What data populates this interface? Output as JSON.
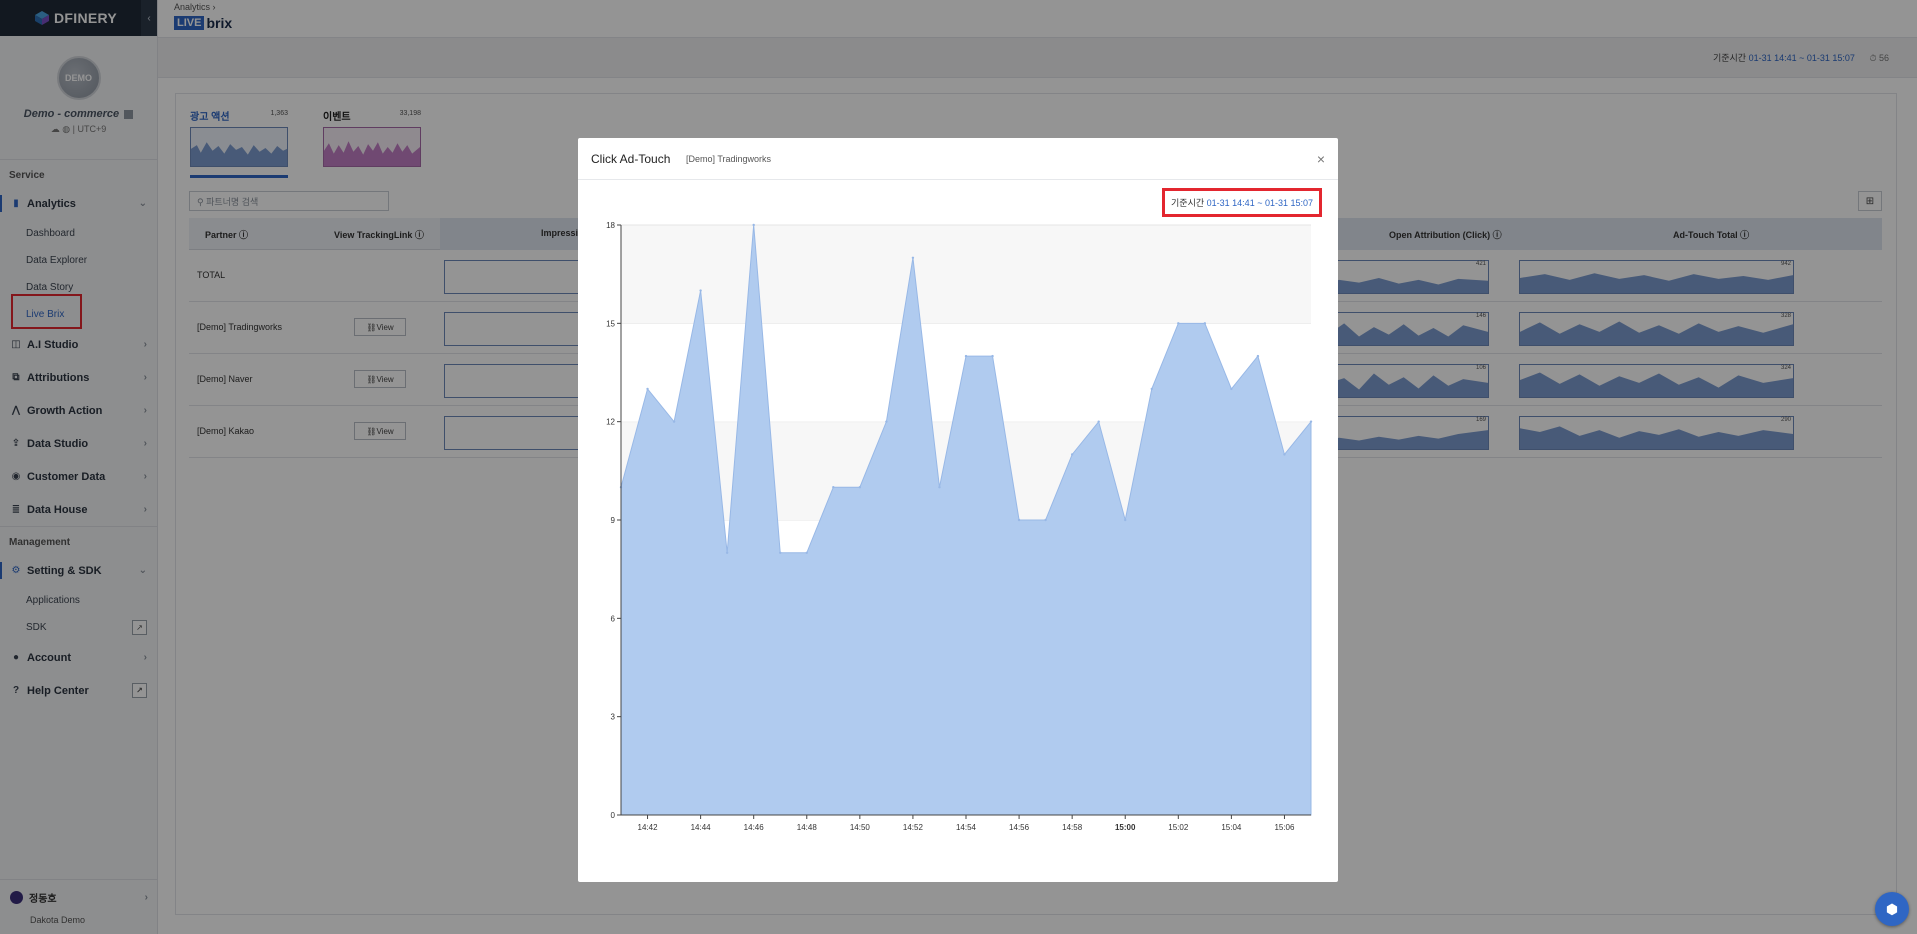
{
  "sidebar": {
    "logo": "DFINERY",
    "profile": {
      "avatar_text": "DEMO",
      "app_name": "Demo - commerce",
      "timezone": "UTC+9"
    },
    "section_service": "Service",
    "section_management": "Management",
    "analytics": {
      "label": "Analytics",
      "children": [
        "Dashboard",
        "Data Explorer",
        "Data Story",
        "Live Brix"
      ]
    },
    "items": [
      "A.I Studio",
      "Attributions",
      "Growth Action",
      "Data Studio",
      "Customer Data",
      "Data House"
    ],
    "setting": {
      "label": "Setting & SDK",
      "children": [
        "Applications",
        "SDK"
      ]
    },
    "account": "Account",
    "help_center": "Help Center",
    "user": {
      "name": "정동호",
      "org": "Dakota Demo"
    }
  },
  "header": {
    "breadcrumb": "Analytics",
    "breadcrumb_sep": "›",
    "product_live": "LIVE",
    "product_brix": "brix",
    "base_label": "기준시간",
    "base_range": "01-31 14:41 ~ 01-31 15:07",
    "counter": "⏱ 56"
  },
  "main": {
    "tabs": [
      {
        "label": "광고 액션",
        "count": "1,363"
      },
      {
        "label": "이벤트",
        "count": "33,198"
      }
    ],
    "search_placeholder": "파트너명 검색",
    "columns": [
      "Partner",
      "View TrackingLink",
      "Impression",
      "Open Attribution (Click)",
      "Ad-Touch Total"
    ],
    "rows": [
      {
        "partner": "TOTAL",
        "view": "",
        "open_attr_total": "421",
        "adtouch_total": "942"
      },
      {
        "partner": "[Demo] Tradingworks",
        "view": "View",
        "open_attr_total": "146",
        "adtouch_total": "328"
      },
      {
        "partner": "[Demo] Naver",
        "view": "View",
        "open_attr_total": "106",
        "adtouch_total": "324"
      },
      {
        "partner": "[Demo] Kakao",
        "view": "View",
        "open_attr_total": "169",
        "adtouch_total": "290"
      }
    ]
  },
  "modal": {
    "title": "Click Ad-Touch",
    "subtitle": "[Demo] Tradingworks",
    "close": "×",
    "base_label": "기준시간",
    "base_range": "01-31 14:41 ~ 01-31 15:07"
  },
  "colors": {
    "accent": "#2f66c4",
    "area_fill": "#b0cbef",
    "area_stroke": "#98b8e6",
    "highlight": "#e3262f"
  },
  "chart_data": {
    "type": "area",
    "title": "",
    "xlabel": "",
    "ylabel": "",
    "x": [
      "14:41",
      "14:42",
      "14:43",
      "14:44",
      "14:45",
      "14:46",
      "14:47",
      "14:48",
      "14:49",
      "14:50",
      "14:51",
      "14:52",
      "14:53",
      "14:54",
      "14:55",
      "14:56",
      "14:57",
      "14:58",
      "14:59",
      "15:00",
      "15:01",
      "15:02",
      "15:03",
      "15:04",
      "15:05",
      "15:06",
      "15:07"
    ],
    "values": [
      10,
      13,
      12,
      16,
      8,
      18,
      8,
      8,
      10,
      10,
      12,
      17,
      10,
      14,
      14,
      9,
      9,
      11,
      12,
      9,
      13,
      15,
      15,
      13,
      14,
      11,
      12
    ],
    "x_tick_labels": [
      "14:42",
      "14:44",
      "14:46",
      "14:48",
      "14:50",
      "14:52",
      "14:54",
      "14:56",
      "14:58",
      "15:00",
      "15:02",
      "15:04",
      "15:06"
    ],
    "x_tick_bold": "15:00",
    "y_ticks": [
      0,
      3,
      6,
      9,
      12,
      15,
      18
    ],
    "ylim": [
      0,
      18
    ],
    "grid": "horizontal bands"
  }
}
